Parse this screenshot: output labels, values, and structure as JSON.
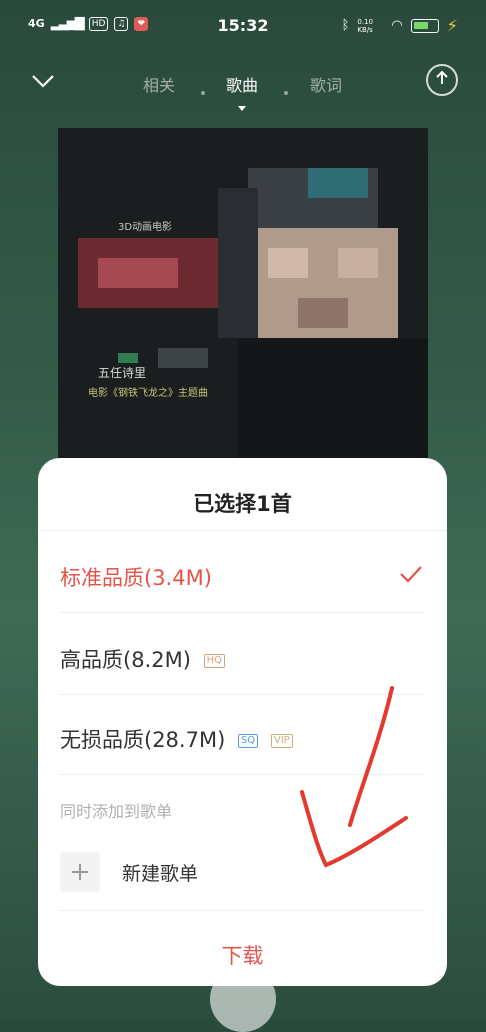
{
  "status_bar": {
    "network": "4G",
    "hd_badge": "HD",
    "time": "15:32",
    "speed": "0.10 KB/s"
  },
  "nav": {
    "tabs": [
      {
        "label": "相关",
        "active": false
      },
      {
        "label": "歌曲",
        "active": true
      },
      {
        "label": "歌词",
        "active": false
      }
    ]
  },
  "album_cover": {
    "text_top": "3D动画电影",
    "text_singer": "五任诗里",
    "text_movie": "电影《钢铁飞龙之》主题曲"
  },
  "sheet": {
    "title": "已选择1首",
    "options": [
      {
        "label": "标准品质(3.4M)",
        "selected": true,
        "tags": []
      },
      {
        "label": "高品质(8.2M)",
        "selected": false,
        "tags": [
          "HQ"
        ]
      },
      {
        "label": "无损品质(28.7M)",
        "selected": false,
        "tags": [
          "SQ",
          "VIP"
        ]
      }
    ],
    "add_to_playlist_label": "同时添加到歌单",
    "new_playlist_label": "新建歌单",
    "download_label": "下载"
  },
  "colors": {
    "accent": "#e5534b",
    "background": "#335a48"
  }
}
